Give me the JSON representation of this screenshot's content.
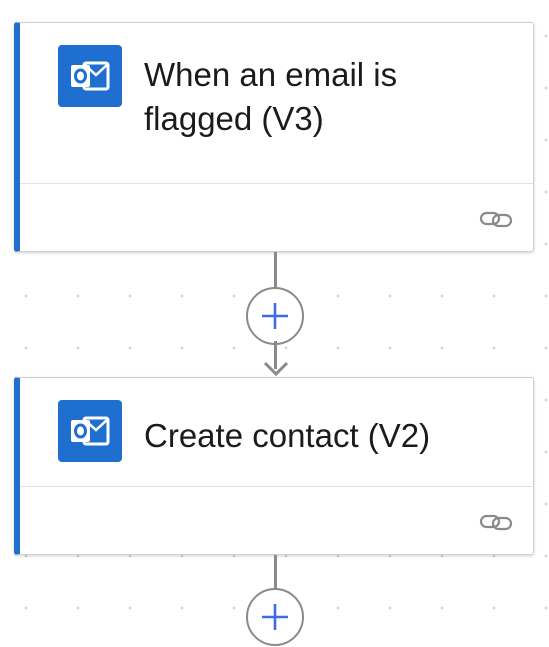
{
  "flow": {
    "steps": [
      {
        "title": "When an email is flagged (V3)",
        "icon": "outlook-icon",
        "connection_icon": "link-icon"
      },
      {
        "title": "Create contact (V2)",
        "icon": "outlook-icon",
        "connection_icon": "link-icon"
      }
    ],
    "add_step_icon": "plus-icon"
  },
  "colors": {
    "accent": "#1f6fd1",
    "connector": "#8a8a8a",
    "plus": "#3b6fe0"
  }
}
